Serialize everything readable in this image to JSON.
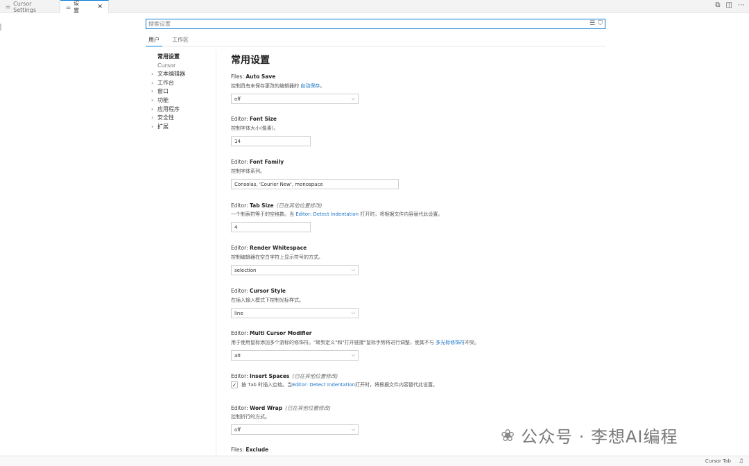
{
  "tabs": [
    {
      "icon": "settings-lines-icon",
      "label": "Cursor Settings",
      "active": false
    },
    {
      "icon": "settings-lines-icon",
      "label": "设置",
      "active": true
    }
  ],
  "tab_close_glyph": "✕",
  "search": {
    "placeholder": "搜索设置"
  },
  "scope_tabs": [
    "用户",
    "工作区"
  ],
  "toc": {
    "selected": "常用设置",
    "sub": "Cursor",
    "items": [
      "文本编辑器",
      "工作台",
      "窗口",
      "功能",
      "应用程序",
      "安全性",
      "扩展"
    ]
  },
  "main": {
    "title": "常用设置",
    "settings": [
      {
        "prefix": "Files: ",
        "name": "Auto Save",
        "modified": "",
        "desc": "控制具有未保存更改的编辑器的 ",
        "desc_link": "自动保存",
        "desc_after": "。",
        "control": "select",
        "value": "off"
      },
      {
        "prefix": "Editor: ",
        "name": "Font Size",
        "modified": "",
        "desc": "控制字体大小(像素)。",
        "desc_link": "",
        "desc_after": "",
        "control": "input-sm",
        "value": "14"
      },
      {
        "prefix": "Editor: ",
        "name": "Font Family",
        "modified": "",
        "desc": "控制字体系列。",
        "desc_link": "",
        "desc_after": "",
        "control": "input-lg",
        "value": "Consolas, 'Courier New', monospace"
      },
      {
        "prefix": "Editor: ",
        "name": "Tab Size",
        "modified": "(已在其他位置修改)",
        "desc": "一个制表符等于的空格数。当 ",
        "desc_link": "Editor: Detect Indentation",
        "desc_after": " 打开时，将根据文件内容替代此设置。",
        "control": "input-sm",
        "value": "4"
      },
      {
        "prefix": "Editor: ",
        "name": "Render Whitespace",
        "modified": "",
        "desc": "控制编辑器在空白字符上显示符号的方式。",
        "desc_link": "",
        "desc_after": "",
        "control": "select",
        "value": "selection"
      },
      {
        "prefix": "Editor: ",
        "name": "Cursor Style",
        "modified": "",
        "desc": "在插入输入模式下控制光标样式。",
        "desc_link": "",
        "desc_after": "",
        "control": "select",
        "value": "line"
      },
      {
        "prefix": "Editor: ",
        "name": "Multi Cursor Modifier",
        "modified": "",
        "desc": "用于使用鼠标添加多个游标的修饰符。\"转到定义\"和\"打开链接\"鼠标手势将进行调整，使其不与 ",
        "desc_link": "多光标修饰符",
        "desc_after": "冲突。",
        "control": "select",
        "value": "alt"
      },
      {
        "prefix": "Editor: ",
        "name": "Insert Spaces",
        "modified": "(已在其他位置修改)",
        "desc": "时插入空格。当 ",
        "desc_link": "Editor: Detect Indentation",
        "desc_after": " 打开时，将根据文件内容替代此设置。",
        "control": "checkbox",
        "value": "按",
        "key": "Tab"
      },
      {
        "prefix": "Editor: ",
        "name": "Word Wrap",
        "modified": "(已在其他位置修改)",
        "desc": "控制折行的方式。",
        "desc_link": "",
        "desc_after": "",
        "control": "select",
        "value": "off"
      },
      {
        "prefix": "Files: ",
        "name": "Exclude",
        "modified": "",
        "desc": "",
        "desc_link": "",
        "desc_after": "",
        "control": "none",
        "value": ""
      }
    ]
  },
  "watermark": {
    "text": "公众号 · 李想AI编程"
  },
  "statusbar": {
    "text": "Cursor Tab"
  }
}
